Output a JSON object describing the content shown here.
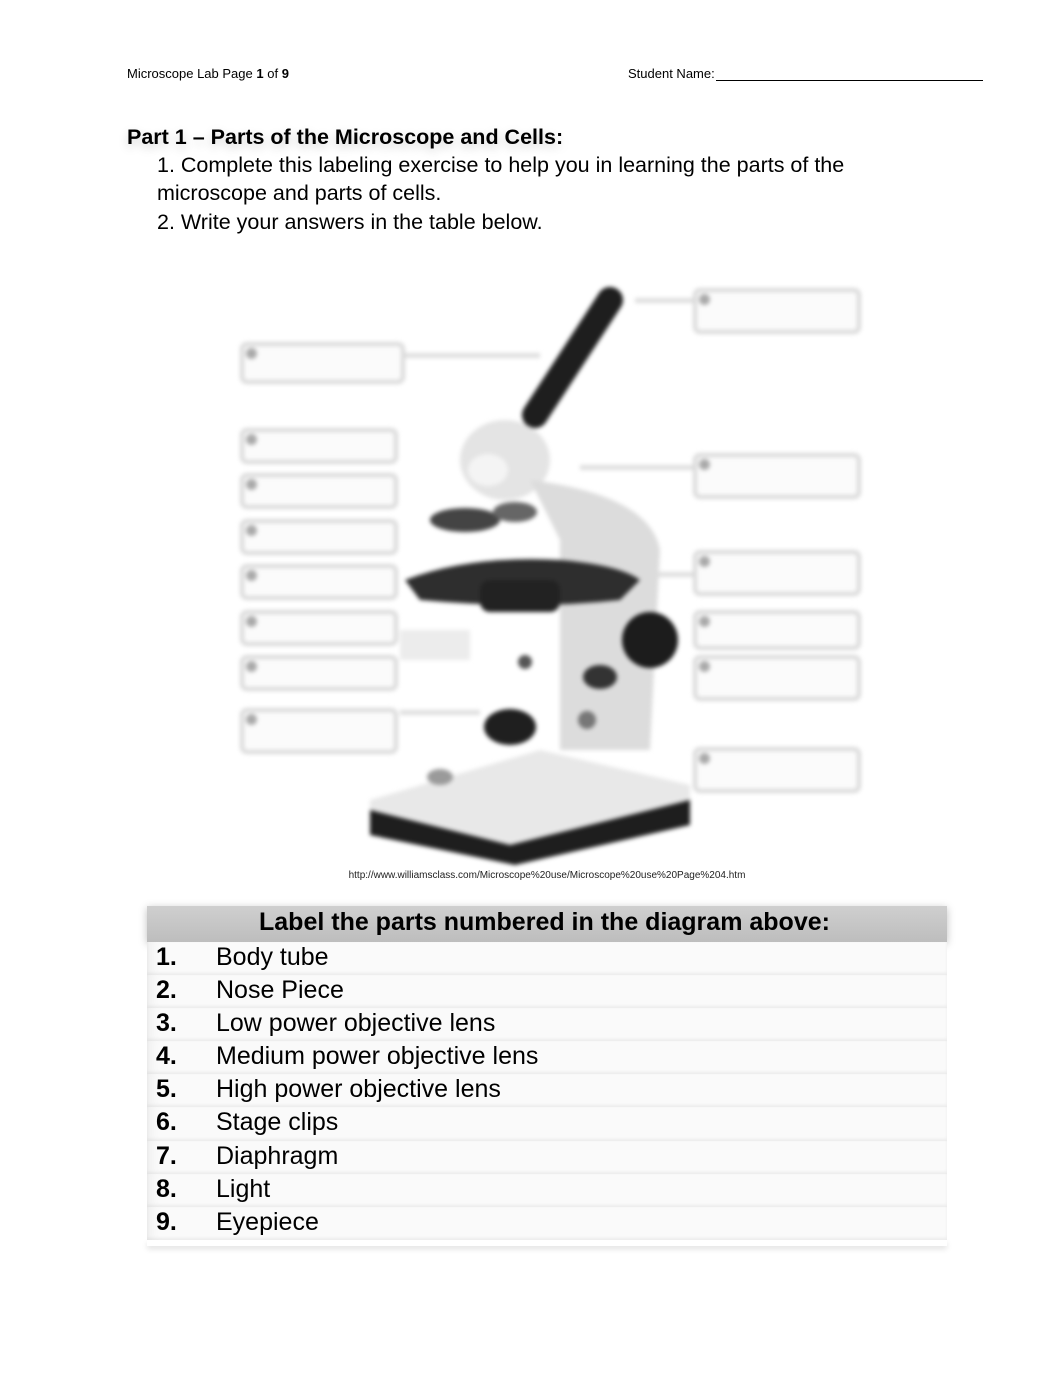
{
  "header": {
    "doc_title": "Microscope Lab Page",
    "page_current": "1",
    "page_of": "of",
    "page_total": "9",
    "student_name_label": "Student Name:"
  },
  "part": {
    "title": "Part 1 –  Parts of the Microscope and Cells:",
    "instructions": [
      "1.  Complete this labeling exercise to help you in learning the parts of the microscope and parts of cells.",
      "2.  Write your answers in the table below."
    ]
  },
  "diagram": {
    "subject": "microscope-diagram",
    "source_url": "http://www.williamsclass.com/Microscope%20use/Microscope%20use%20Page%204.htm"
  },
  "answer_table": {
    "header": "Label the parts numbered in the diagram above:",
    "rows": [
      {
        "num": "1.",
        "label": "Body tube"
      },
      {
        "num": "2.",
        "label": "Nose Piece"
      },
      {
        "num": "3.",
        "label": "Low power objective lens"
      },
      {
        "num": "4.",
        "label": "Medium power objective lens"
      },
      {
        "num": "5.",
        "label": "High power objective lens"
      },
      {
        "num": "6.",
        "label": "Stage clips"
      },
      {
        "num": "7.",
        "label": "Diaphragm"
      },
      {
        "num": "8.",
        "label": "Light"
      },
      {
        "num": "9.",
        "label": "Eyepiece"
      }
    ]
  }
}
